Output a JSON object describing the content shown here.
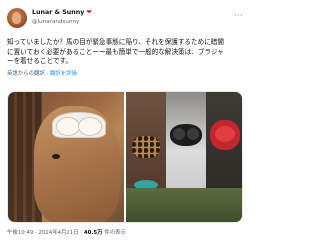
{
  "author": {
    "name": "Lunar & Sunny",
    "heart_emoji": "❤",
    "handle": "@lunarandsunny"
  },
  "menu_glyph": "···",
  "post": {
    "lines": [
      "知っていましたか？馬の目が緊急事態に陥り、それを保護するために暗闇",
      "に置いておく必要があることーー最も簡単で一般的な解決策は、ブラジャ",
      "ーを着せることです。"
    ]
  },
  "translation": {
    "prefix": "英語からの翻訳",
    "link": "翻訳を評価"
  },
  "images": [
    {
      "name": "horse-with-bra-closeup"
    },
    {
      "name": "three-horses-with-bras"
    }
  ],
  "footer": {
    "time": "午後10:49",
    "date": "2024年4月21日",
    "views_count": "40.5万",
    "views_label": "件の表示"
  },
  "colors": {
    "link": "#1d9bf0",
    "muted": "#536471",
    "text": "#0f1419"
  }
}
